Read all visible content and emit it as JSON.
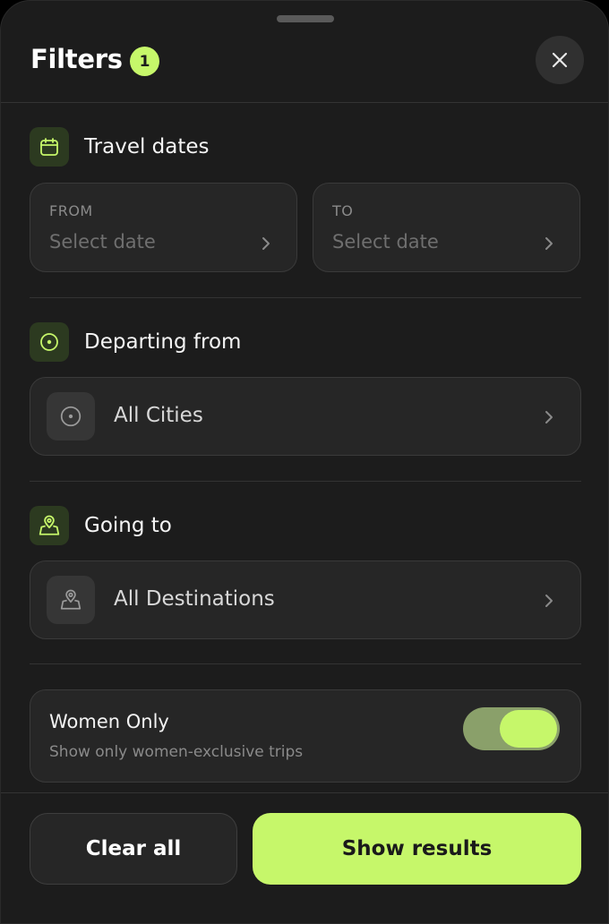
{
  "header": {
    "title": "Filters",
    "active_count": "1"
  },
  "travel_dates": {
    "label": "Travel dates",
    "from": {
      "caption": "FROM",
      "placeholder": "Select date"
    },
    "to": {
      "caption": "TO",
      "placeholder": "Select date"
    }
  },
  "departing": {
    "label": "Departing from",
    "value": "All Cities"
  },
  "going_to": {
    "label": "Going to",
    "value": "All Destinations"
  },
  "women_only": {
    "title": "Women Only",
    "subtitle": "Show only women-exclusive trips",
    "enabled": true
  },
  "footer": {
    "clear_label": "Clear all",
    "show_label": "Show results"
  },
  "colors": {
    "accent": "#c6f76a",
    "background": "#1c1c1c",
    "card": "#262626"
  },
  "icons": [
    "close-icon",
    "calendar-icon",
    "location-target-icon",
    "map-pin-icon",
    "chevron-right-icon"
  ]
}
